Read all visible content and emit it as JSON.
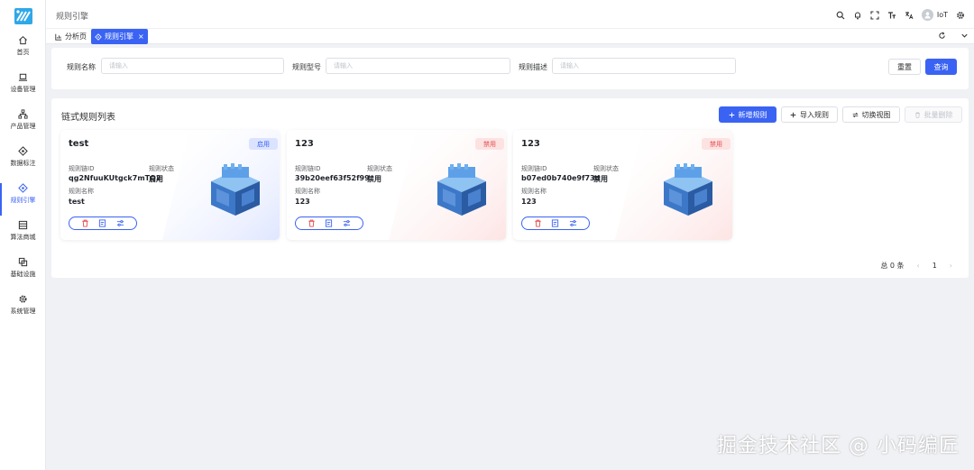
{
  "header": {
    "breadcrumb": "规则引擎",
    "user_name": "IoT"
  },
  "sidebar": {
    "items": [
      {
        "label": "首页",
        "icon": "home-icon"
      },
      {
        "label": "设备管理",
        "icon": "laptop-icon"
      },
      {
        "label": "产品管理",
        "icon": "hierarchy-icon"
      },
      {
        "label": "数据标注",
        "icon": "target-icon"
      },
      {
        "label": "规则引擎",
        "icon": "rule-engine-icon",
        "active": true
      },
      {
        "label": "算法商城",
        "icon": "store-icon"
      },
      {
        "label": "基础设施",
        "icon": "layers-icon"
      },
      {
        "label": "系统管理",
        "icon": "gear-icon"
      }
    ]
  },
  "tabs": [
    {
      "label": "分析页",
      "icon": "chart-icon"
    },
    {
      "label": "规则引擎",
      "icon": "rule-engine-icon",
      "active": true,
      "close": "×"
    }
  ],
  "search": {
    "name_label": "规则名称",
    "name_placeholder": "请输入",
    "type_label": "规则型号",
    "type_placeholder": "请输入",
    "desc_label": "规则描述",
    "desc_placeholder": "请输入",
    "reset_label": "重置",
    "query_label": "查询"
  },
  "list": {
    "title": "链式规则列表",
    "add_label": "新增规则",
    "import_label": "导入规则",
    "switch_label": "切换视图",
    "batch_delete_label": "批量删除",
    "id_key": "规则链ID",
    "status_key": "规则状态",
    "name_key": "规则名称",
    "cards": [
      {
        "title": "test",
        "badge": "启用",
        "id": "qg2NfuuKUtgck7mTQ2",
        "status": "启用",
        "name": "test",
        "enabled": true
      },
      {
        "title": "123",
        "badge": "禁用",
        "id": "39b20eef63f52f99",
        "status": "禁用",
        "name": "123",
        "enabled": false
      },
      {
        "title": "123",
        "badge": "禁用",
        "id": "b07ed0b740e9f73d",
        "status": "禁用",
        "name": "123",
        "enabled": false
      }
    ]
  },
  "pagination": {
    "total": "总 0 条",
    "prev": "‹",
    "page": "1",
    "next": "›"
  },
  "watermark": "掘金技术社区 @ 小码编匠",
  "colors": {
    "primary": "#3a63f3",
    "enabled_badge_bg": "#dbe3ff",
    "disabled_badge_bg": "#fde2e2",
    "disabled_text": "#e34d4d"
  }
}
